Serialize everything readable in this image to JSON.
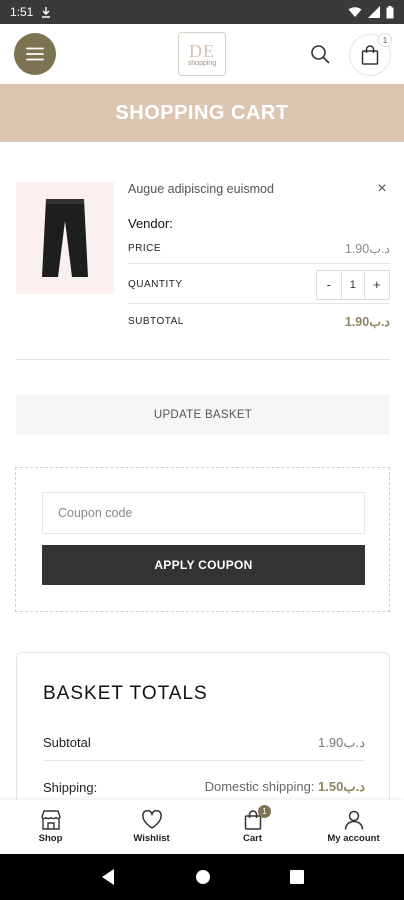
{
  "status_bar": {
    "time": "1:51",
    "icons": [
      "download-icon",
      "wifi-icon",
      "signal-icon",
      "battery-icon"
    ]
  },
  "header": {
    "logo_text": "DE",
    "logo_sub": "shopping",
    "cart_count": "1"
  },
  "page": {
    "title": "SHOPPING CART"
  },
  "cart_item": {
    "name": "Augue adipiscing euismod",
    "vendor_label": "Vendor:",
    "price_label": "PRICE",
    "price_value": "1.90د.ب",
    "quantity_label": "QUANTITY",
    "quantity_value": "1",
    "minus": "-",
    "plus": "+",
    "subtotal_label": "SUBTOTAL",
    "subtotal_value": "1.90د.ب",
    "remove": "×"
  },
  "update_basket": {
    "label": "UPDATE BASKET"
  },
  "coupon": {
    "placeholder": "Coupon code",
    "apply_label": "APPLY COUPON"
  },
  "totals": {
    "title": "BASKET TOTALS",
    "subtotal_label": "Subtotal",
    "subtotal_value": "1.90د.ب",
    "shipping_label": "Shipping:",
    "shipping_prefix": "Domestic shipping:",
    "shipping_value": "1.50د.ب"
  },
  "bottom_nav": [
    {
      "label": "Shop"
    },
    {
      "label": "Wishlist"
    },
    {
      "label": "Cart",
      "badge": "1"
    },
    {
      "label": "My account"
    }
  ],
  "colors": {
    "accent": "#7b7352",
    "banner": "#dcc6b1",
    "button_dark": "#333333",
    "price_gold": "#8f8462"
  }
}
